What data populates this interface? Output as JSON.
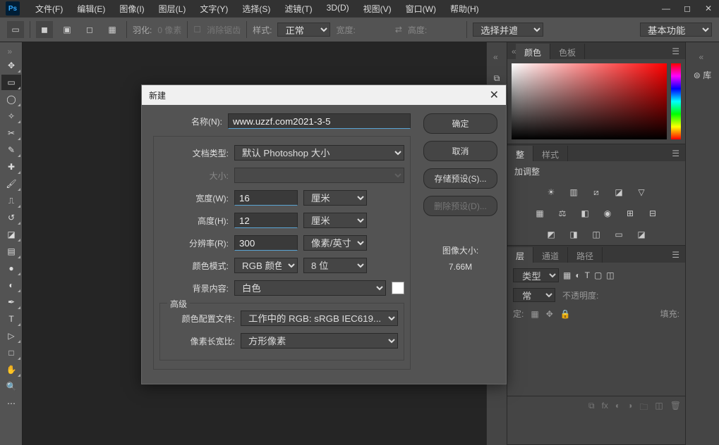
{
  "menu": {
    "file": "文件(F)",
    "edit": "编辑(E)",
    "image": "图像(I)",
    "layer": "图层(L)",
    "type": "文字(Y)",
    "select": "选择(S)",
    "filter": "滤镜(T)",
    "threeD": "3D(D)",
    "view": "视图(V)",
    "window": "窗口(W)",
    "help": "帮助(H)"
  },
  "options": {
    "feather_label": "羽化:",
    "feather_value": "0 像素",
    "antialias": "消除锯齿",
    "style_label": "样式:",
    "style_value": "正常",
    "width_label": "宽度:",
    "height_label": "高度:",
    "select_mask": "选择并遮住 ...",
    "workspace": "基本功能"
  },
  "panels": {
    "color_tab": "颜色",
    "swatch_tab": "色板",
    "adjust_tab_short": "整",
    "styles_tab": "样式",
    "add_adjust": "加调整",
    "layers_tab_short": "层",
    "channels_tab": "通道",
    "paths_tab": "路径",
    "layer_kind": "类型",
    "blend_mode": "常",
    "opacity_label": "不透明度:",
    "lock_label": "定:",
    "fill_label": "填充:",
    "library": "库"
  },
  "dialog": {
    "title": "新建",
    "name_label": "名称(N):",
    "name_value": "www.uzzf.com2021-3-5",
    "preset_label": "文档类型:",
    "preset_value": "默认 Photoshop 大小",
    "size_label": "大小:",
    "width_label": "宽度(W):",
    "width_value": "16",
    "width_unit": "厘米",
    "height_label": "高度(H):",
    "height_value": "12",
    "height_unit": "厘米",
    "res_label": "分辨率(R):",
    "res_value": "300",
    "res_unit": "像素/英寸",
    "mode_label": "颜色模式:",
    "mode_value": "RGB 颜色",
    "depth_value": "8 位",
    "bg_label": "背景内容:",
    "bg_value": "白色",
    "advanced": "高级",
    "profile_label": "颜色配置文件:",
    "profile_value": "工作中的 RGB: sRGB IEC619...",
    "aspect_label": "像素长宽比:",
    "aspect_value": "方形像素",
    "ok": "确定",
    "cancel": "取消",
    "save_preset": "存储预设(S)...",
    "delete_preset": "删除预设(D)...",
    "image_size_label": "图像大小:",
    "image_size_value": "7.66M"
  }
}
